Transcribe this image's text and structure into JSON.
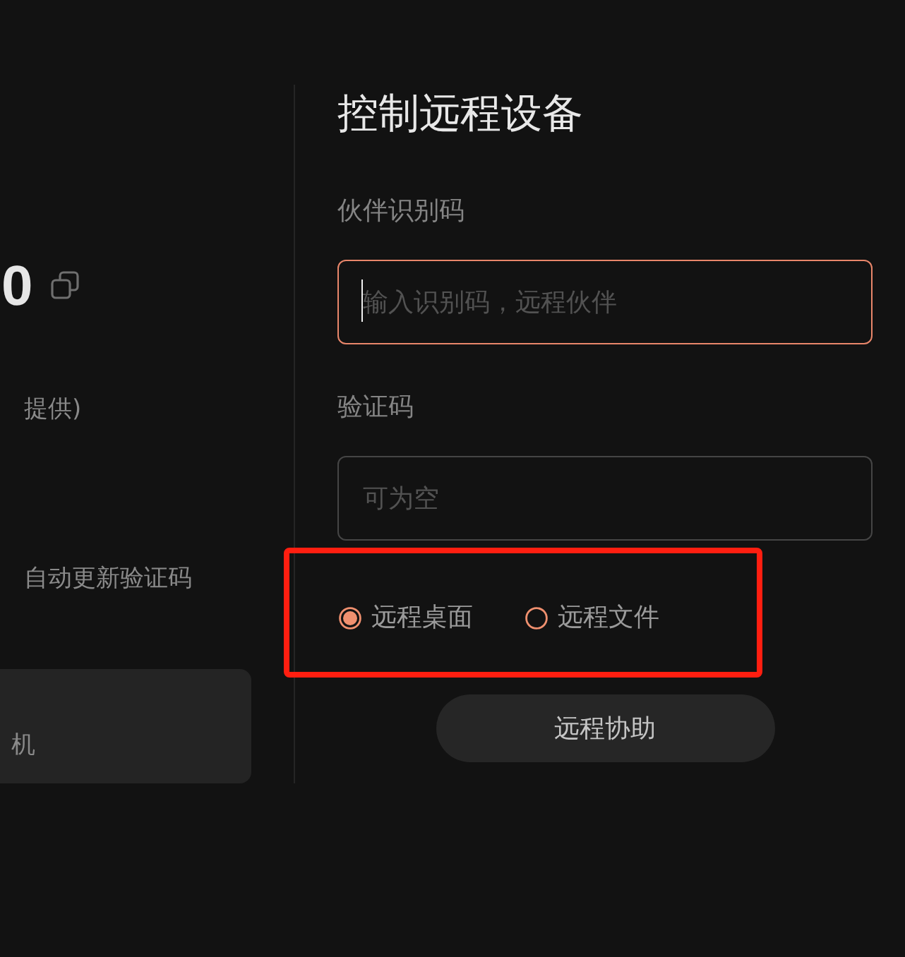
{
  "left_panel": {
    "id_number": "0",
    "note_1": "提供)",
    "note_2": "自动更新验证码",
    "card": {
      "text": "机"
    }
  },
  "control_panel": {
    "title": "控制远程设备",
    "fields": [
      {
        "label": "伙伴识别码",
        "placeholder": "输入识别码，远程伙伴",
        "focused": true
      },
      {
        "label": "验证码",
        "placeholder": "可为空",
        "focused": false
      }
    ],
    "modes": [
      {
        "label": "远程桌面",
        "selected": true
      },
      {
        "label": "远程文件",
        "selected": false
      }
    ],
    "button": "远程协助"
  },
  "annotation": {
    "kind": "highlight_box"
  }
}
